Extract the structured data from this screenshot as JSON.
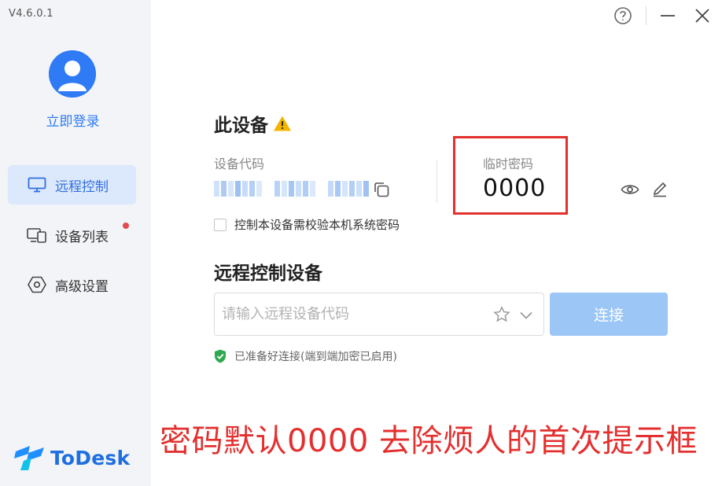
{
  "app": {
    "version": "V4.6.0.1",
    "brand": "ToDesk"
  },
  "sidebar": {
    "login_label": "立即登录",
    "items": [
      {
        "label": "远程控制",
        "icon": "monitor-icon",
        "active": true
      },
      {
        "label": "设备列表",
        "icon": "devices-icon",
        "badge_dot": true
      },
      {
        "label": "高级设置",
        "icon": "hexagon-gear-icon"
      }
    ]
  },
  "window_controls": [
    "help-icon",
    "minimize-icon",
    "close-icon"
  ],
  "this_device": {
    "title": "此设备",
    "code_label": "设备代码",
    "code_value": "hidden",
    "temp_password_label": "临时密码",
    "temp_password_value": "0000",
    "verify_checkbox_label": "控制本设备需校验本机系统密码",
    "verify_checked": false
  },
  "remote_control": {
    "title": "远程控制设备",
    "input_placeholder": "请输入远程设备代码",
    "input_value": "",
    "connect_label": "连接",
    "status_text": "已准备好连接(端到端加密已启用)"
  },
  "annotation": {
    "text": "密码默认0000 去除烦人的首次提示框"
  },
  "colors": {
    "accent": "#2f7bf5",
    "sidebar_bg": "#f2f4f7",
    "active_nav_bg": "#dce8fb",
    "connect_button": "#9cc6f6",
    "annotation_red": "#e3302f",
    "warning_yellow": "#f5b400",
    "status_green": "#2fa84f"
  }
}
